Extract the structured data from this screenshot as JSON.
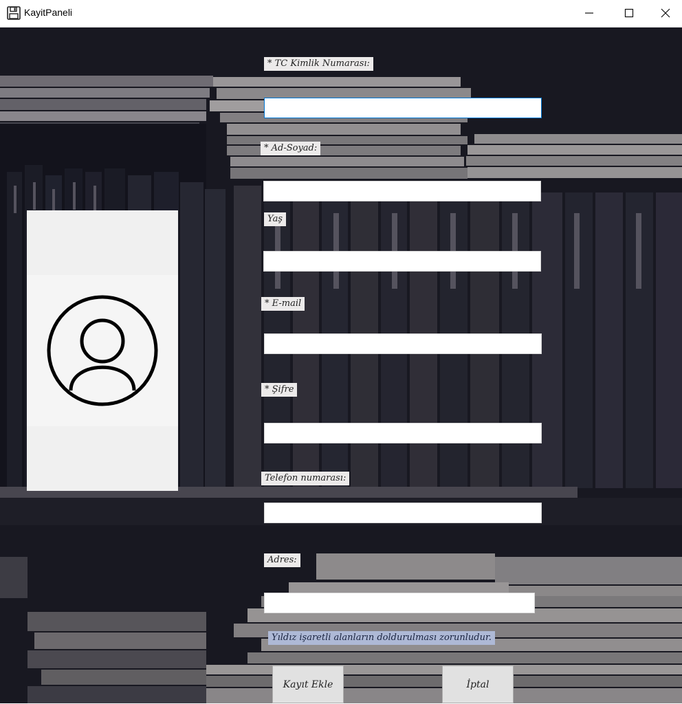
{
  "window": {
    "title": "KayitPaneli"
  },
  "form": {
    "tc_label": "* TC Kimlik Numarası:",
    "tc_value": "",
    "name_label": "* Ad-Soyad:",
    "name_value": "",
    "age_label": "Yaş",
    "age_value": "",
    "email_label": "* E-mail",
    "email_value": "",
    "password_label": "* Şifre",
    "password_value": "",
    "phone_label": "Telefon numarası:",
    "phone_value": "",
    "address_label": "Adres:",
    "address_value": "",
    "required_note": "Yıldız işaretli alanların doldurulması zorunludur."
  },
  "buttons": {
    "add_label": "Kayıt Ekle",
    "cancel_label": "İptal"
  },
  "icons": {
    "app": "floppy-disk-icon",
    "profile": "user-avatar-icon"
  },
  "colors": {
    "focus_border": "#0078d7",
    "note_bg": "#aeb9d6",
    "background": "#1c1c24"
  }
}
